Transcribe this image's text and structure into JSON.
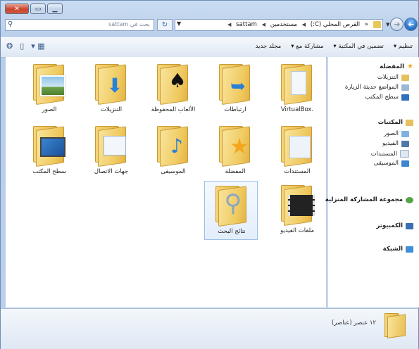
{
  "window": {
    "caption_buttons": [
      "close-icon",
      "maximize-icon",
      "minimize-icon"
    ]
  },
  "address_bar": {
    "search_placeholder": "بحث في sattam",
    "breadcrumbs": [
      "القرص المحلي (C:)",
      "مستخدمين",
      "sattam"
    ],
    "overflow": "«"
  },
  "toolbar": {
    "organize": "تنظيم",
    "include_in_library": "تضمين في المكتبة",
    "share_with": "مشاركة مع",
    "new_folder": "مجلد جديد"
  },
  "items": [
    {
      "label": "VirtualBox.",
      "emblem": "document-icon"
    },
    {
      "label": "ارتباطات",
      "emblem": "link-arrow-icon"
    },
    {
      "label": "الألعاب المحفوظة",
      "emblem": "chess-pieces-icon"
    },
    {
      "label": "التنزيلات",
      "emblem": "download-arrow-icon"
    },
    {
      "label": "الصور",
      "emblem": "landscape-photo-icon"
    },
    {
      "label": "المستندات",
      "emblem": "document-icon"
    },
    {
      "label": "المفضلة",
      "emblem": "star-icon"
    },
    {
      "label": "الموسيقى",
      "emblem": "music-note-icon"
    },
    {
      "label": "جهات الاتصال",
      "emblem": "contact-card-icon"
    },
    {
      "label": "سطح المكتب",
      "emblem": "desktop-icon"
    },
    {
      "label": "ملفات الفيديو",
      "emblem": "film-icon"
    },
    {
      "label": "نتائج البحث",
      "emblem": "magnifier-icon"
    }
  ],
  "nav_pane": {
    "favorites": "المفضلة",
    "favorites_items": [
      "التنزيلات",
      "المواضع حديثة الزيارة",
      "سطح المكتب"
    ],
    "libraries": "المكتبات",
    "libraries_items": [
      "الصور",
      "الفيديو",
      "المستندات",
      "الموسيقى"
    ],
    "homegroup": "مجموعة المشاركة المنزلية",
    "computer": "الكمبيوتر",
    "network": "الشبكة"
  },
  "details": {
    "count": "١٢ عنصر (عناصر)"
  }
}
